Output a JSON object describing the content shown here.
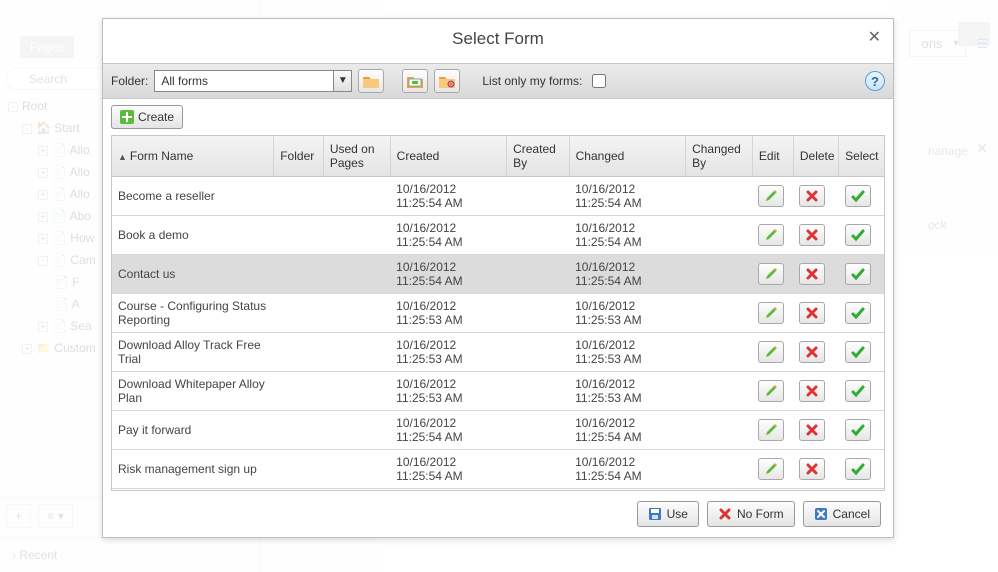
{
  "background": {
    "pages_tab": "Pages",
    "search_placeholder": "Search",
    "tree": {
      "root": "Root",
      "start": "Start",
      "items": [
        "Allo",
        "Allo",
        "Allo",
        "Abo",
        "How",
        "Cam",
        "F",
        "A",
        "Sea"
      ],
      "custom": "Custom"
    },
    "recent": "Recent",
    "options_btn": "ons",
    "right_items": [
      "nanage",
      "ock"
    ]
  },
  "dialog": {
    "title": "Select Form",
    "toolbar": {
      "folder_label": "Folder:",
      "folder_value": "All forms",
      "my_forms_label": "List only my forms:"
    },
    "create_label": "Create",
    "columns": {
      "form_name": "Form Name",
      "folder": "Folder",
      "used_on": "Used on Pages",
      "created": "Created",
      "created_by": "Created By",
      "changed": "Changed",
      "changed_by": "Changed By",
      "edit": "Edit",
      "delete": "Delete",
      "select": "Select"
    },
    "rows": [
      {
        "name": "Become a reseller",
        "created": "10/16/2012 11:25:54 AM",
        "changed": "10/16/2012 11:25:54 AM",
        "hl": false
      },
      {
        "name": "Book a demo",
        "created": "10/16/2012 11:25:54 AM",
        "changed": "10/16/2012 11:25:54 AM",
        "hl": false
      },
      {
        "name": "Contact us",
        "created": "10/16/2012 11:25:54 AM",
        "changed": "10/16/2012 11:25:54 AM",
        "hl": true
      },
      {
        "name": "Course - Configuring Status Reporting",
        "created": "10/16/2012 11:25:53 AM",
        "changed": "10/16/2012 11:25:53 AM",
        "hl": false
      },
      {
        "name": "Download Alloy Track Free Trial",
        "created": "10/16/2012 11:25:53 AM",
        "changed": "10/16/2012 11:25:53 AM",
        "hl": false
      },
      {
        "name": "Download Whitepaper Alloy Plan",
        "created": "10/16/2012 11:25:53 AM",
        "changed": "10/16/2012 11:25:53 AM",
        "hl": false
      },
      {
        "name": "Pay it forward",
        "created": "10/16/2012 11:25:54 AM",
        "changed": "10/16/2012 11:25:54 AM",
        "hl": false
      },
      {
        "name": "Risk management sign up",
        "created": "10/16/2012 11:25:54 AM",
        "changed": "10/16/2012 11:25:54 AM",
        "hl": false
      }
    ],
    "footer": {
      "use": "Use",
      "no_form": "No Form",
      "cancel": "Cancel"
    }
  }
}
